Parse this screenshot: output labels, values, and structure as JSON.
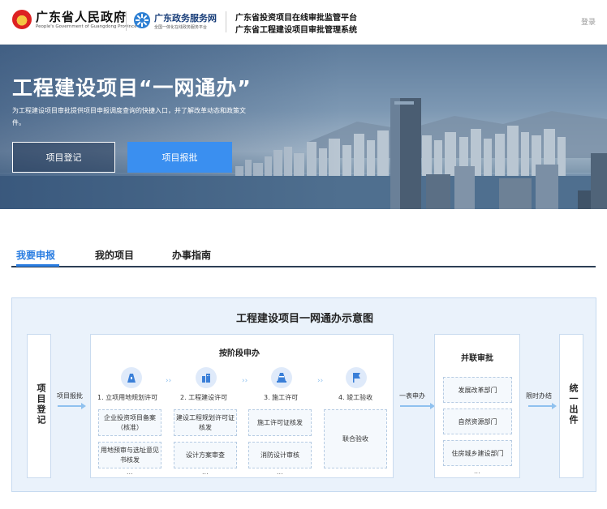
{
  "header": {
    "gov_title": "广东省人民政府",
    "gov_subtitle": "People's Government of Guangdong Province",
    "service_title": "广东政务服务网",
    "service_subtitle": "全国一体化在线政务服务平台",
    "platform_line1": "广东省投资项目在线审批监管平台",
    "platform_line2": "广东省工程建设项目审批管理系统",
    "login": "登录"
  },
  "hero": {
    "title": "工程建设项目“一网通办”",
    "description": "为工程建设项目审批提供项目申报调度查询的快捷入口，并了解改革动态和政策文件。",
    "button_register": "项目登记",
    "button_approve": "项目报批"
  },
  "tabs": [
    {
      "label": "我要申报",
      "active": true
    },
    {
      "label": "我的项目",
      "active": false
    },
    {
      "label": "办事指南",
      "active": false
    }
  ],
  "diagram": {
    "title": "工程建设项目一网通办示意图",
    "left_box": "项目登记",
    "arrow1": "项目报批",
    "stage_heading": "按阶段申办",
    "stages": [
      {
        "label": "1. 立项用地规划许可",
        "items": [
          "企业投资项目备案（核准）",
          "用地预审与选址意见书核发"
        ],
        "more": "..."
      },
      {
        "label": "2. 工程建设许可",
        "items": [
          "建设工程规划许可证核发",
          "设计方案审查"
        ],
        "more": "..."
      },
      {
        "label": "3. 施工许可",
        "items": [
          "施工许可证核发",
          "消防设计审核"
        ],
        "more": "..."
      },
      {
        "label": "4. 竣工验收",
        "items": [
          "联合验收"
        ],
        "more": ""
      }
    ],
    "arrow2": "一表申办",
    "parallel_heading": "并联审批",
    "parallel_items": [
      "发展改革部门",
      "自然资源部门",
      "住房城乡建设部门"
    ],
    "parallel_more": "...",
    "arrow3": "限时办结",
    "right_box": "统一出件"
  },
  "colors": {
    "accent": "#2a7de1",
    "button_blue": "#3a8ff0",
    "diagram_bg": "#eaf2fb"
  }
}
